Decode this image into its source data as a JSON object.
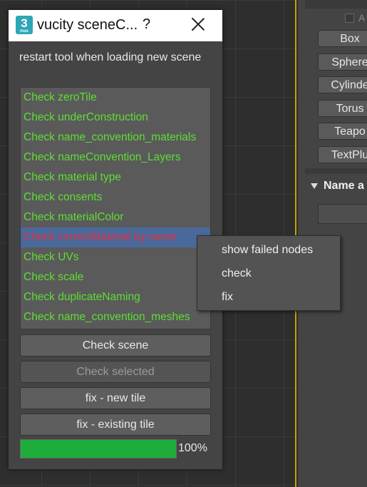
{
  "dialog": {
    "title": "vucity sceneC...",
    "icon_text": "3",
    "icon_subtext": "max",
    "help_label": "?",
    "notice": "restart tool when loading new scene",
    "checks": [
      {
        "label": "Check zeroTile",
        "status": "pass"
      },
      {
        "label": "Check underConstruction",
        "status": "pass"
      },
      {
        "label": "Check name_convention_materials",
        "status": "pass"
      },
      {
        "label": "Check nameConvention_Layers",
        "status": "pass"
      },
      {
        "label": "Check material type",
        "status": "pass"
      },
      {
        "label": "Check consents",
        "status": "pass"
      },
      {
        "label": "Check materialColor",
        "status": "pass"
      },
      {
        "label": "Check correctMaterial by name",
        "status": "fail"
      },
      {
        "label": "Check UVs",
        "status": "pass"
      },
      {
        "label": "Check scale",
        "status": "pass"
      },
      {
        "label": "Check duplicateNaming",
        "status": "pass"
      },
      {
        "label": "Check name_convention_meshes",
        "status": "pass"
      }
    ],
    "buttons": {
      "check_scene": "Check scene",
      "check_selected": "Check selected",
      "fix_new_tile": "fix - new tile",
      "fix_existing_tile": "fix - existing tile"
    },
    "progress": {
      "value": 100,
      "label": "100%"
    }
  },
  "context_menu": {
    "items": [
      "show failed nodes",
      "check",
      "fix"
    ]
  },
  "command_panel": {
    "checkbox_label": "A",
    "object_buttons": [
      "Box",
      "Sphere",
      "Cylinde",
      "Torus",
      "Teapo",
      "TextPlu"
    ],
    "rollout_title": "Name a"
  },
  "colors": {
    "pass": "#5dde32",
    "fail": "#e0303e",
    "selected_row": "#49699b",
    "progress": "#1ead3b",
    "viewport_border": "#c8a200"
  }
}
